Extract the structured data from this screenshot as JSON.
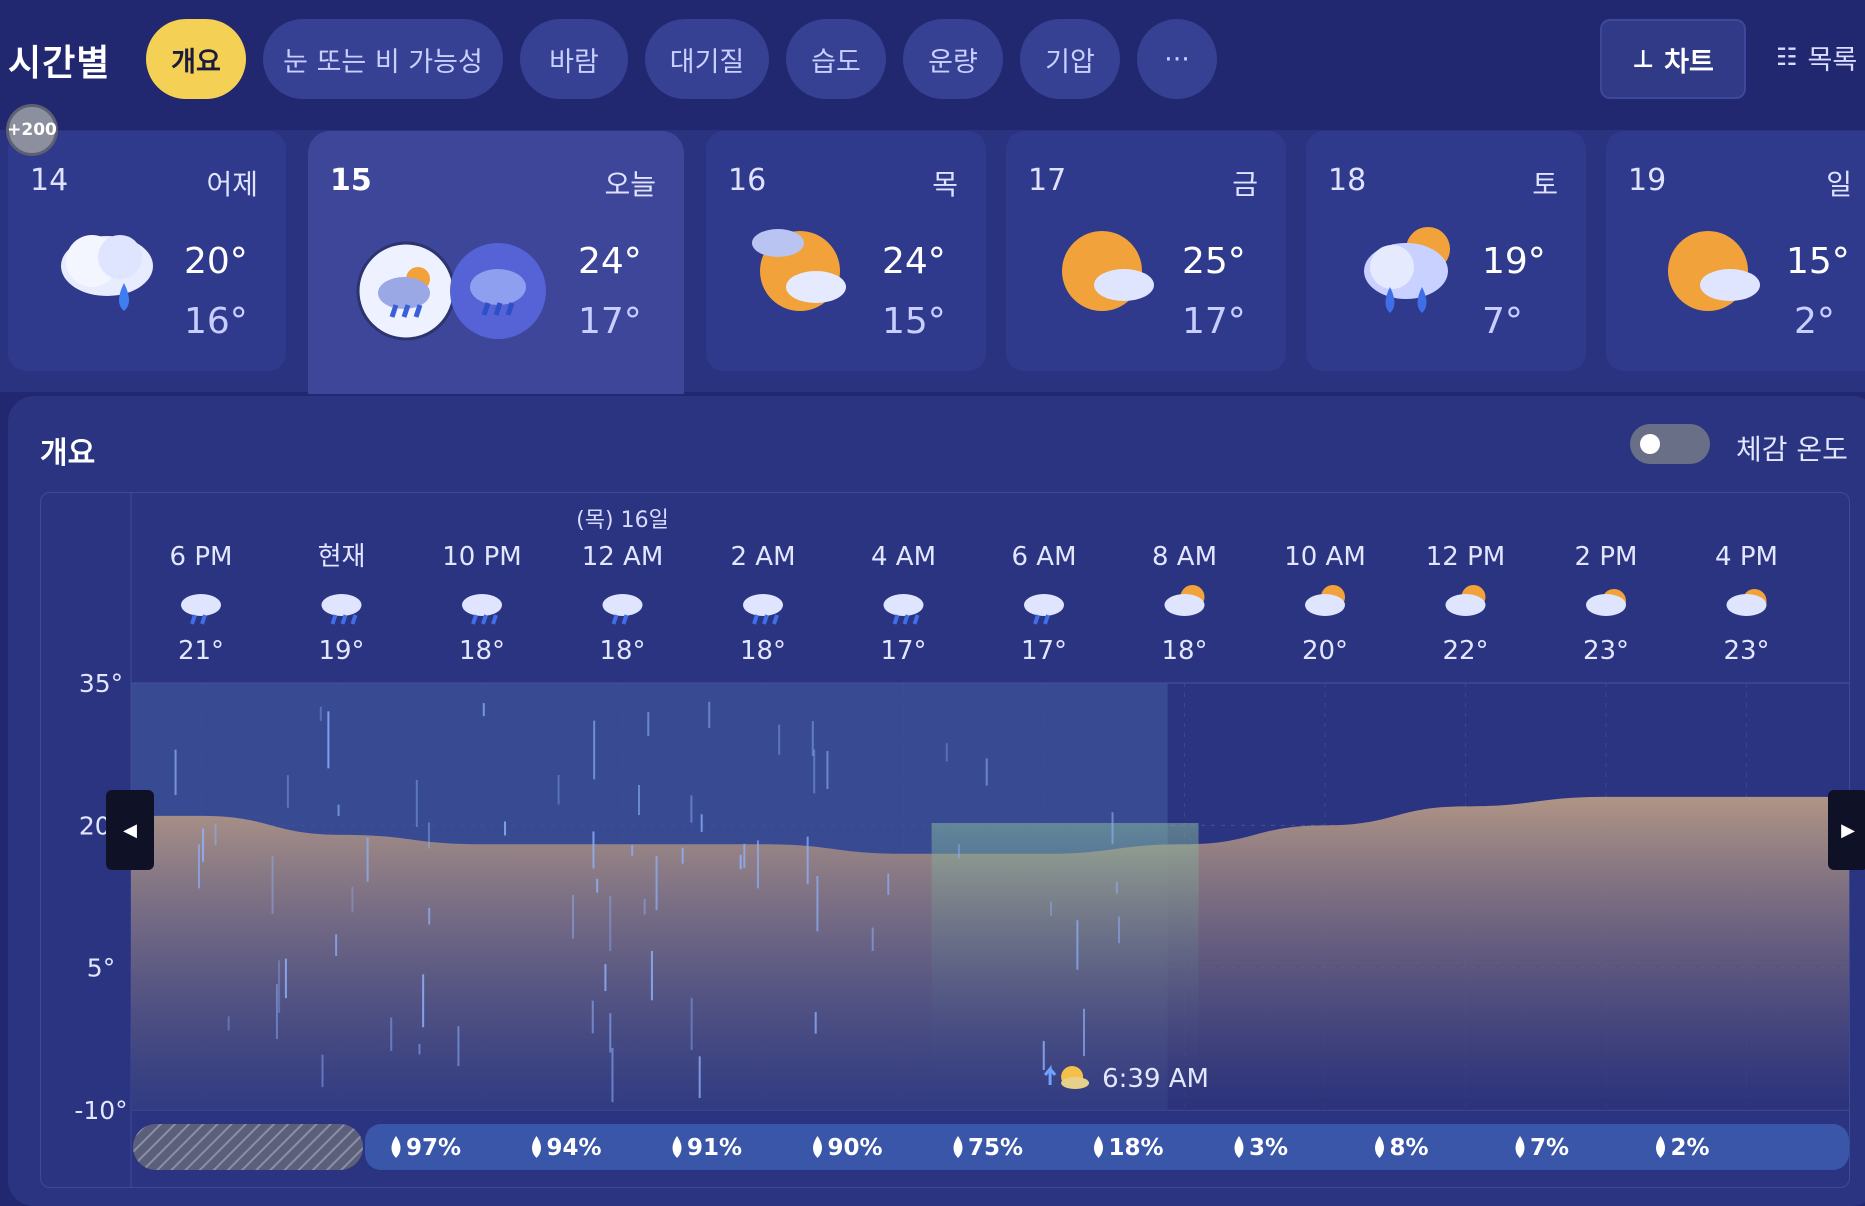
{
  "header": {
    "title": "시간별",
    "tabs": [
      {
        "label": "개요",
        "active": true
      },
      {
        "label": "눈 또는 비 가능성"
      },
      {
        "label": "바람"
      },
      {
        "label": "대기질"
      },
      {
        "label": "습도"
      },
      {
        "label": "운량"
      },
      {
        "label": "기압"
      },
      {
        "label": "···"
      }
    ],
    "view_chart_label": "차트",
    "view_list_label": "목록"
  },
  "badge": "+200",
  "days": [
    {
      "num": "14",
      "name": "어제",
      "hi": "20°",
      "lo": "16°",
      "icon": "cloud-rain-icon"
    },
    {
      "num": "15",
      "name": "오늘",
      "hi": "24°",
      "lo": "17°",
      "icon": "partly-cloudy-rain-icon",
      "today": true
    },
    {
      "num": "16",
      "name": "목",
      "hi": "24°",
      "lo": "15°",
      "icon": "sun-behind-clouds-icon"
    },
    {
      "num": "17",
      "name": "금",
      "hi": "25°",
      "lo": "17°",
      "icon": "partly-sunny-icon"
    },
    {
      "num": "18",
      "name": "토",
      "hi": "19°",
      "lo": "7°",
      "icon": "cloud-rain-sun-icon"
    },
    {
      "num": "19",
      "name": "일",
      "hi": "15°",
      "lo": "2°",
      "icon": "partly-sunny-icon"
    }
  ],
  "panel": {
    "title": "개요",
    "toggle_label": "체감 온도"
  },
  "colors": {
    "background": "#212870",
    "accent": "#f4d054",
    "precip_bar": "#3a56a8",
    "temp_area": "#b79a86"
  },
  "chart_data": {
    "type": "area",
    "date_marker": "(목) 16일",
    "hours": [
      "6 PM",
      "현재",
      "10 PM",
      "12 AM",
      "2 AM",
      "4 AM",
      "6 AM",
      "8 AM",
      "10 AM",
      "12 PM",
      "2 PM",
      "4 PM"
    ],
    "temperature_labels": [
      "21°",
      "19°",
      "18°",
      "18°",
      "18°",
      "17°",
      "17°",
      "18°",
      "20°",
      "22°",
      "23°",
      "23°"
    ],
    "temperatures": [
      21,
      19,
      18,
      18,
      18,
      17,
      17,
      18,
      20,
      22,
      23,
      23
    ],
    "hour_icons": [
      "cloud-rain-icon",
      "cloud-heavy-rain-icon",
      "cloud-heavy-rain-icon",
      "cloud-rain-icon",
      "cloud-heavy-rain-icon",
      "cloud-heavy-rain-icon",
      "cloud-rain-icon",
      "sun-behind-clouds-icon",
      "sun-behind-clouds-icon",
      "sun-behind-clouds-icon",
      "partly-sunny-icon",
      "partly-sunny-icon"
    ],
    "y_ticks": [
      "35°",
      "20°",
      "5°",
      "-10°"
    ],
    "ylim": [
      -10,
      35
    ],
    "precipitation": [
      "97%",
      "94%",
      "91%",
      "90%",
      "75%",
      "18%",
      "3%",
      "8%",
      "7%",
      "2%"
    ],
    "sunrise_label": "6:39 AM",
    "rain_shaded_until_index": 7
  }
}
